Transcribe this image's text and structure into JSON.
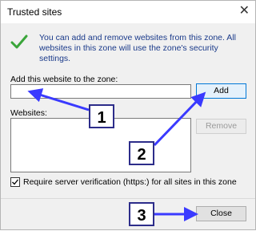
{
  "window": {
    "title": "Trusted sites",
    "close_glyph": "✕"
  },
  "info": {
    "text": "You can add and remove websites from this zone. All websites in this zone will use the zone's security settings."
  },
  "add": {
    "label": "Add this website to the zone:",
    "value": "",
    "button": "Add"
  },
  "websites": {
    "label": "Websites:",
    "items": [],
    "remove_button": "Remove"
  },
  "verify": {
    "label": "Require server verification (https:) for all sites in this zone",
    "checked": true
  },
  "footer": {
    "close_button": "Close"
  },
  "callouts": [
    "1",
    "2",
    "3"
  ],
  "colors": {
    "arrow": "#3a3aff",
    "check": "#3aa53a",
    "accent": "#0078d7"
  }
}
